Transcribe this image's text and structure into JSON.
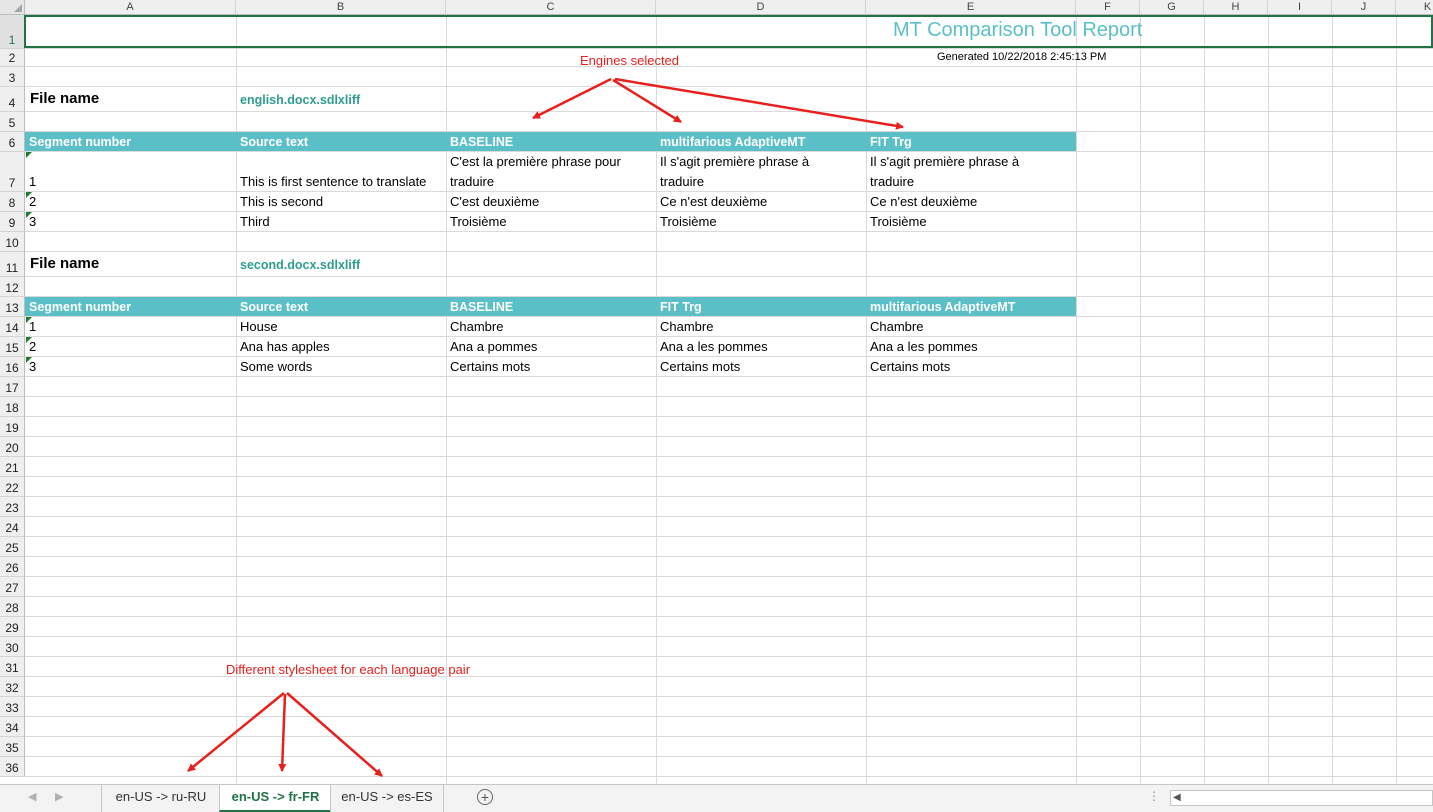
{
  "columns": [
    "A",
    "B",
    "C",
    "D",
    "E",
    "F",
    "G",
    "H",
    "I",
    "J",
    "K"
  ],
  "rows": [
    "1",
    "2",
    "3",
    "4",
    "5",
    "6",
    "7",
    "8",
    "9",
    "10",
    "11",
    "12",
    "13",
    "14",
    "15",
    "16",
    "17",
    "18",
    "19",
    "20",
    "21",
    "22",
    "23",
    "24",
    "25",
    "26",
    "27",
    "28",
    "29",
    "30",
    "31",
    "32",
    "33",
    "34",
    "35",
    "36"
  ],
  "report": {
    "title": "MT Comparison Tool Report",
    "generated": "Generated 10/22/2018 2:45:13 PM"
  },
  "file1": {
    "label": "File name",
    "name": "english.docx.sdlxliff",
    "headers": [
      "Segment number",
      "Source text",
      "BASELINE",
      "multifarious AdaptiveMT",
      "FIT Trg"
    ],
    "rows": [
      [
        "1",
        "This is first sentence to translate",
        "C'est la première phrase pour traduire",
        "Il s'agit première phrase à traduire",
        "Il s'agit première phrase à traduire"
      ],
      [
        "2",
        "This is second",
        "C'est deuxième",
        "Ce n'est deuxième",
        "Ce n'est deuxième"
      ],
      [
        "3",
        "Third",
        "Troisième",
        "Troisième",
        "Troisième"
      ]
    ]
  },
  "file2": {
    "label": "File name",
    "name": "second.docx.sdlxliff",
    "headers": [
      "Segment number",
      "Source text",
      "BASELINE",
      "FIT Trg",
      "multifarious AdaptiveMT"
    ],
    "rows": [
      [
        "1",
        "House",
        "Chambre",
        "Chambre",
        "Chambre"
      ],
      [
        "2",
        "Ana has apples",
        "Ana a pommes",
        "Ana a les pommes",
        "Ana a les pommes"
      ],
      [
        "3",
        "Some words",
        "Certains mots",
        "Certains mots",
        "Certains mots"
      ]
    ]
  },
  "annotations": {
    "engines": "Engines selected",
    "stylesheet": "Different stylesheet for each language pair",
    "color": "#e8201c"
  },
  "sheet_tabs": [
    {
      "label": "en-US -> ru-RU",
      "active": false
    },
    {
      "label": "en-US -> fr-FR",
      "active": true
    },
    {
      "label": "en-US -> es-ES",
      "active": false
    }
  ],
  "colors": {
    "header_band": "#5bbfc7",
    "title": "#5bbfc7",
    "filename": "#2e9d8f",
    "excel_green": "#217346"
  }
}
